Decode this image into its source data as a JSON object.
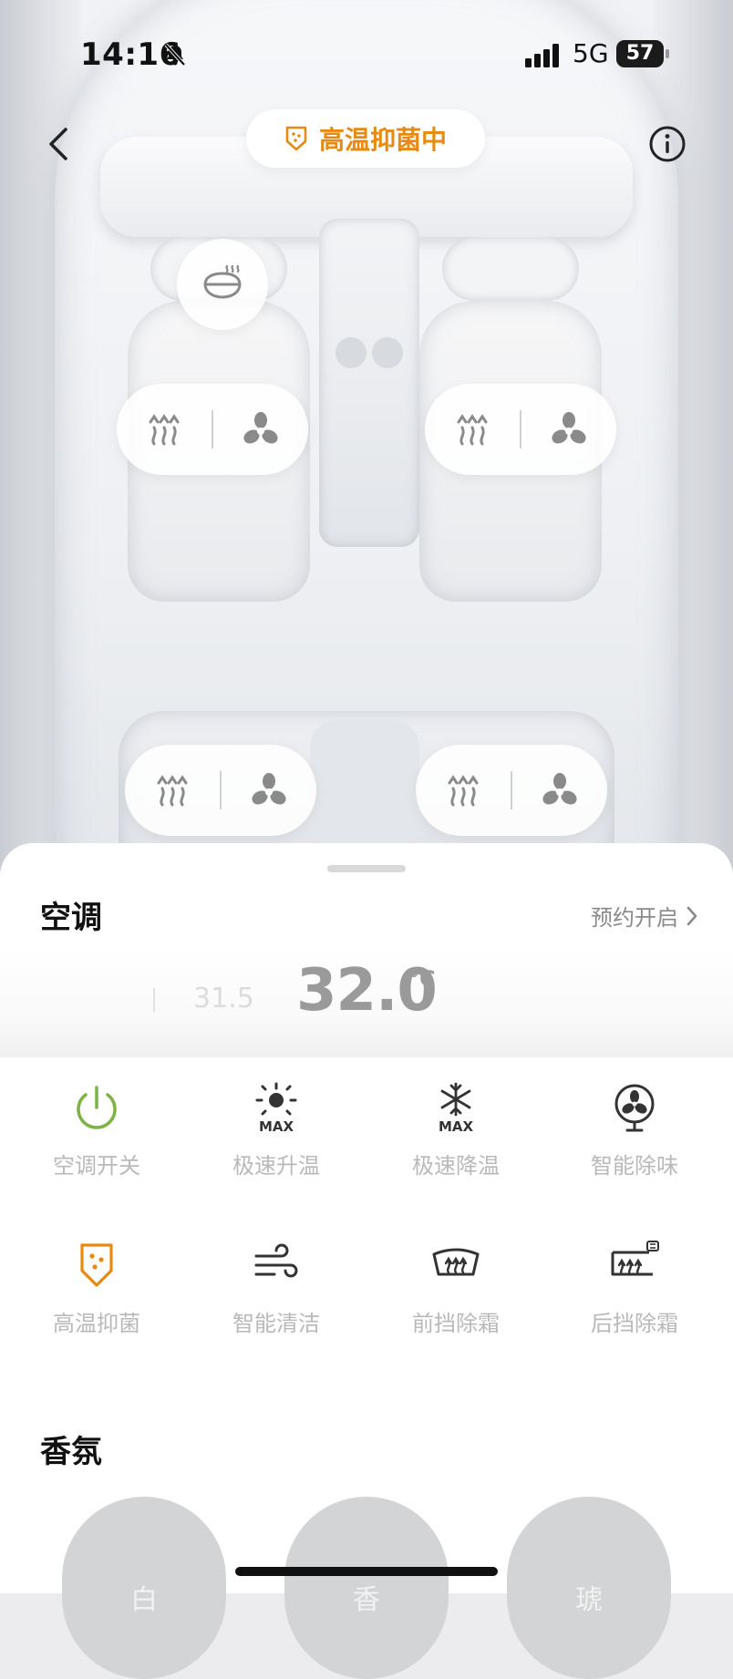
{
  "status_bar": {
    "time": "14:16",
    "network": "5G",
    "battery": "57",
    "battery_level": 0.57
  },
  "header": {
    "mode_label": "高温抑菌中",
    "accent_color": "#e88a12"
  },
  "seat_controls": {
    "steering_heat": {
      "icon": "steering-wheel-heat-icon"
    },
    "seats": [
      {
        "position": "front-left",
        "heat_icon": "seat-heat-icon",
        "vent_icon": "seat-ventilation-icon"
      },
      {
        "position": "front-right",
        "heat_icon": "seat-heat-icon",
        "vent_icon": "seat-ventilation-icon"
      },
      {
        "position": "rear-left",
        "heat_icon": "seat-heat-icon",
        "vent_icon": "seat-ventilation-icon"
      },
      {
        "position": "rear-right",
        "heat_icon": "seat-heat-icon",
        "vent_icon": "seat-ventilation-icon"
      }
    ]
  },
  "ac": {
    "title": "空调",
    "schedule_label": "预约开启",
    "temp_prev": "31.5",
    "temp_current": "32.0",
    "temp_unit": "°C",
    "functions": [
      {
        "label": "空调开关",
        "icon": "power-icon",
        "color": "#7cb342"
      },
      {
        "label": "极速升温",
        "icon": "sun-max-icon",
        "color": "#333333"
      },
      {
        "label": "极速降温",
        "icon": "snowflake-max-icon",
        "color": "#333333"
      },
      {
        "label": "智能除味",
        "icon": "fan-deodorize-icon",
        "color": "#333333"
      },
      {
        "label": "高温抑菌",
        "icon": "shield-sterilize-icon",
        "color": "#e88a12"
      },
      {
        "label": "智能清洁",
        "icon": "wind-clean-icon",
        "color": "#333333"
      },
      {
        "label": "前挡除霜",
        "icon": "front-defrost-icon",
        "color": "#333333"
      },
      {
        "label": "后挡除霜",
        "icon": "rear-defrost-icon",
        "color": "#333333"
      }
    ]
  },
  "fragrance": {
    "title": "香氛",
    "items": [
      {
        "label": "白"
      },
      {
        "label": "香"
      },
      {
        "label": "琥"
      }
    ]
  }
}
